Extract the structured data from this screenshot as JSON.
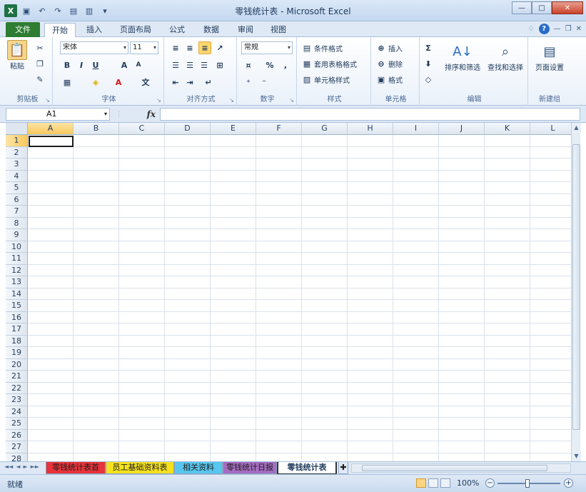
{
  "window": {
    "title": "零钱统计表 - Microsoft Excel",
    "minimize": "—",
    "maximize": "□",
    "close": "✕"
  },
  "tabs": [
    {
      "label": "文件"
    },
    {
      "label": "开始"
    },
    {
      "label": "插入"
    },
    {
      "label": "页面布局"
    },
    {
      "label": "公式"
    },
    {
      "label": "数据"
    },
    {
      "label": "审阅"
    },
    {
      "label": "视图"
    }
  ],
  "ribbon": {
    "clipboard": {
      "label": "剪贴板",
      "paste": "粘贴"
    },
    "font": {
      "label": "字体",
      "name": "宋体",
      "size": "11"
    },
    "alignment": {
      "label": "对齐方式"
    },
    "number": {
      "label": "数字",
      "format": "常规"
    },
    "styles": {
      "label": "样式",
      "conditional": "条件格式",
      "table": "套用表格格式",
      "cell": "单元格样式"
    },
    "cells": {
      "label": "单元格",
      "insert": "插入",
      "delete": "删除",
      "format": "格式"
    },
    "editing": {
      "label": "编辑",
      "sort": "排序和筛选",
      "find": "查找和选择"
    },
    "newgroup": {
      "label": "新建组",
      "pagesetup": "页面设置"
    }
  },
  "formula_bar": {
    "name_box": "A1",
    "fx": "fx",
    "value": ""
  },
  "grid": {
    "columns": [
      "A",
      "B",
      "C",
      "D",
      "E",
      "F",
      "G",
      "H",
      "I",
      "J",
      "K",
      "L"
    ],
    "rows": [
      "1",
      "2",
      "3",
      "4",
      "5",
      "6",
      "7",
      "8",
      "9",
      "10",
      "11",
      "12",
      "13",
      "14",
      "15",
      "16",
      "17",
      "18",
      "19",
      "20",
      "21",
      "22",
      "23",
      "24",
      "25",
      "26",
      "27",
      "28"
    ],
    "active_cell": "A1"
  },
  "sheets": [
    {
      "label": "零钱统计表首",
      "color": "#e8333a"
    },
    {
      "label": "员工基础资料表",
      "color": "#f5e11e"
    },
    {
      "label": "相关资料",
      "color": "#58c6ef"
    },
    {
      "label": "零钱统计日报",
      "color": "#a56cc1"
    },
    {
      "label": "零钱统计表",
      "color": "#ffffff"
    }
  ],
  "status": {
    "ready": "就绪",
    "zoom": "100%"
  }
}
